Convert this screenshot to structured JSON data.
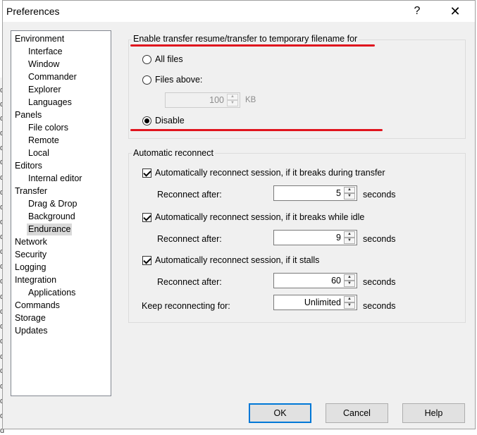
{
  "window": {
    "title": "Preferences",
    "help_glyph": "?",
    "close_glyph": "✕"
  },
  "tree": {
    "items": [
      {
        "label": "Environment",
        "level": 0
      },
      {
        "label": "Interface",
        "level": 1
      },
      {
        "label": "Window",
        "level": 1
      },
      {
        "label": "Commander",
        "level": 1
      },
      {
        "label": "Explorer",
        "level": 1
      },
      {
        "label": "Languages",
        "level": 1
      },
      {
        "label": "Panels",
        "level": 0
      },
      {
        "label": "File colors",
        "level": 1
      },
      {
        "label": "Remote",
        "level": 1
      },
      {
        "label": "Local",
        "level": 1
      },
      {
        "label": "Editors",
        "level": 0
      },
      {
        "label": "Internal editor",
        "level": 1
      },
      {
        "label": "Transfer",
        "level": 0
      },
      {
        "label": "Drag & Drop",
        "level": 1
      },
      {
        "label": "Background",
        "level": 1
      },
      {
        "label": "Endurance",
        "level": 1,
        "selected": true
      },
      {
        "label": "Network",
        "level": 0
      },
      {
        "label": "Security",
        "level": 0
      },
      {
        "label": "Logging",
        "level": 0
      },
      {
        "label": "Integration",
        "level": 0
      },
      {
        "label": "Applications",
        "level": 1
      },
      {
        "label": "Commands",
        "level": 0
      },
      {
        "label": "Storage",
        "level": 0
      },
      {
        "label": "Updates",
        "level": 0
      }
    ]
  },
  "resume": {
    "title": "Enable transfer resume/transfer to temporary filename for",
    "all_files": "All files",
    "files_above": "Files above:",
    "size_value": "100",
    "size_unit": "KB",
    "disable": "Disable",
    "selected": "disable"
  },
  "reconnect": {
    "title": "Automatic reconnect",
    "transfer_label": "Automatically reconnect session, if it breaks during transfer",
    "transfer_checked": true,
    "transfer_after_label": "Reconnect after:",
    "transfer_after_value": "5",
    "idle_label": "Automatically reconnect session, if it breaks while idle",
    "idle_checked": true,
    "idle_after_label": "Reconnect after:",
    "idle_after_value": "9",
    "stalls_label": "Automatically reconnect session, if it stalls",
    "stalls_checked": true,
    "stalls_after_label": "Reconnect after:",
    "stalls_after_value": "60",
    "keep_label": "Keep reconnecting for:",
    "keep_value": "Unlimited",
    "seconds": "seconds"
  },
  "buttons": {
    "ok": "OK",
    "cancel": "Cancel",
    "help": "Help"
  },
  "background_fragment": "d",
  "colors": {
    "annotation": "#e0141e",
    "focus": "#0078d7"
  }
}
